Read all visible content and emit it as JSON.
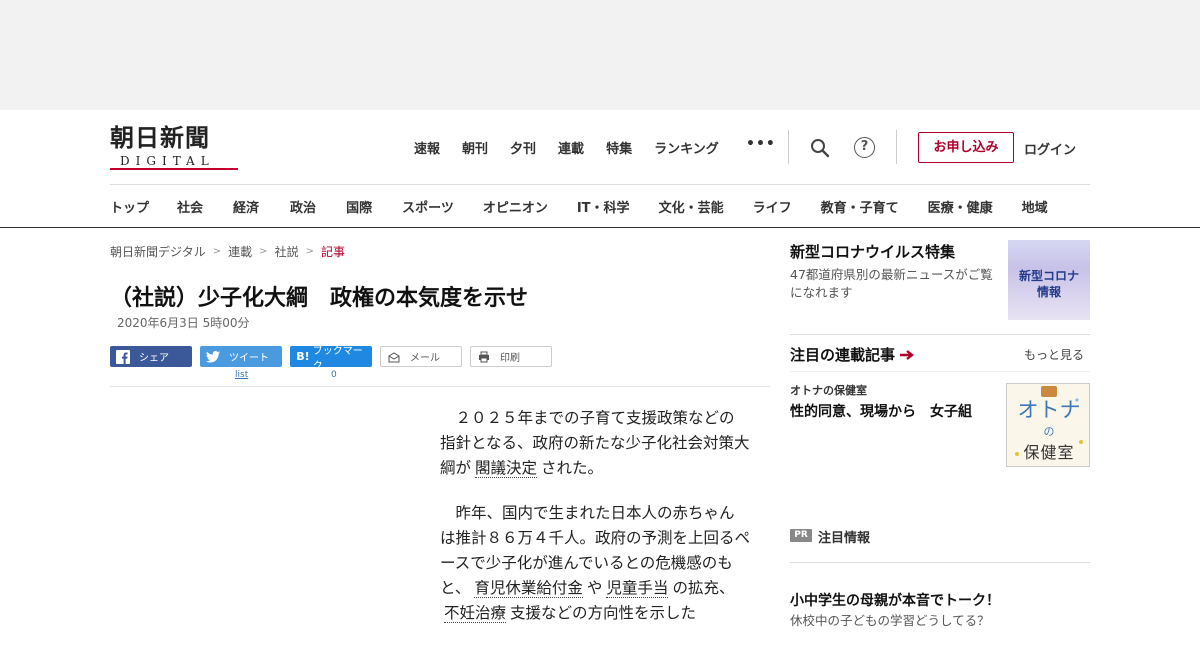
{
  "brand": {
    "logo_main": "朝日新聞",
    "logo_sub": "DIGITAL",
    "accent": "#b0002a"
  },
  "top_nav": [
    "速報",
    "朝刊",
    "夕刊",
    "連載",
    "特集",
    "ランキング"
  ],
  "more_icon": "•••",
  "help_icon": "?",
  "actions": {
    "apply": "お申し込み",
    "login": "ログイン"
  },
  "category_nav": [
    "トップ",
    "社会",
    "経済",
    "政治",
    "国際",
    "スポーツ",
    "オピニオン",
    "IT・科学",
    "文化・芸能",
    "ライフ",
    "教育・子育て",
    "医療・健康",
    "地域"
  ],
  "breadcrumb": [
    "朝日新聞デジタル",
    "連載",
    "社説",
    "記事"
  ],
  "article": {
    "title": "（社説）少子化大綱　政権の本気度を示せ",
    "date": "2020年6月3日 5時00分",
    "share": {
      "facebook": "シェア",
      "twitter": "ツイート",
      "hatena": "ブックマーク",
      "hatena_icon": "B!",
      "mail": "メール",
      "print": "印刷",
      "twitter_count": "list",
      "hatena_count": "0"
    },
    "p1_a": "２０２５年までの子育て支援政策などの指針となる、政府の新たな少子化社会対策大綱が",
    "p1_link": "閣議決定",
    "p1_b": "された。",
    "p2_a": "昨年、国内で生まれた日本人の赤ちゃんは推計８６万４千人。政府の予測を上回るペースで少子化が進んでいるとの危機感のもと、",
    "p2_link1": "育児休業給付金",
    "p2_mid1": "や",
    "p2_link2": "児童手当",
    "p2_mid2": "の拡充、",
    "p2_link3": "不妊治療",
    "p2_b": "支援などの方向性を示した"
  },
  "sidebar": {
    "corona": {
      "title": "新型コロナウイルス特集",
      "desc": "47都道府県別の最新ニュースがご覧になれます",
      "thumb_text_1": "新型コロナ",
      "thumb_text_2": "情報"
    },
    "series": {
      "heading": "注目の連載記事",
      "more": "もっと見る",
      "kicker": "オトナの保健室",
      "title": "性的同意、現場から　女子組",
      "thumb_text_1": "オトナ",
      "thumb_text_2": "の",
      "thumb_text_3": "保健室"
    },
    "pr": {
      "badge": "PR",
      "heading": "注目情報",
      "title": "小中学生の母親が本音でトーク！",
      "sub": "休校中の子どもの学習どうしてる？"
    }
  }
}
